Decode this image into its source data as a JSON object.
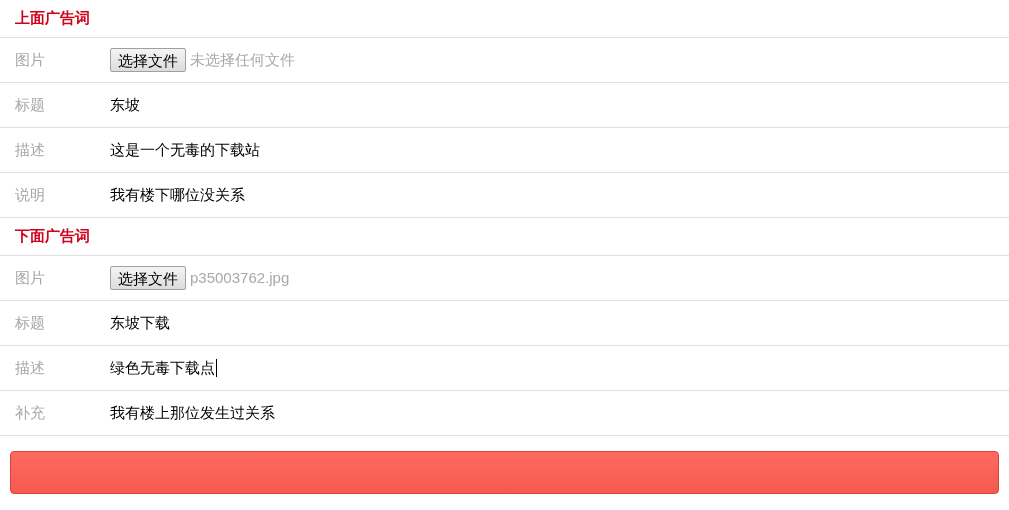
{
  "sections": [
    {
      "heading": "上面广告词",
      "rows": [
        {
          "kind": "file",
          "label": "图片",
          "button": "选择文件",
          "file_name": "未选择任何文件"
        },
        {
          "kind": "text",
          "label": "标题",
          "value": "东坡",
          "focused": false
        },
        {
          "kind": "text",
          "label": "描述",
          "value": "这是一个无毒的下载站",
          "focused": false
        },
        {
          "kind": "text",
          "label": "说明",
          "value": "我有楼下哪位没关系",
          "focused": false
        }
      ]
    },
    {
      "heading": "下面广告词",
      "rows": [
        {
          "kind": "file",
          "label": "图片",
          "button": "选择文件",
          "file_name": "p35003762.jpg"
        },
        {
          "kind": "text",
          "label": "标题",
          "value": "东坡下载",
          "focused": false
        },
        {
          "kind": "text",
          "label": "描述",
          "value": "绿色无毒下载点",
          "focused": true
        },
        {
          "kind": "text",
          "label": "补充",
          "value": "我有楼上那位发生过关系",
          "focused": false
        }
      ]
    }
  ],
  "submit": {
    "kind": "button"
  }
}
